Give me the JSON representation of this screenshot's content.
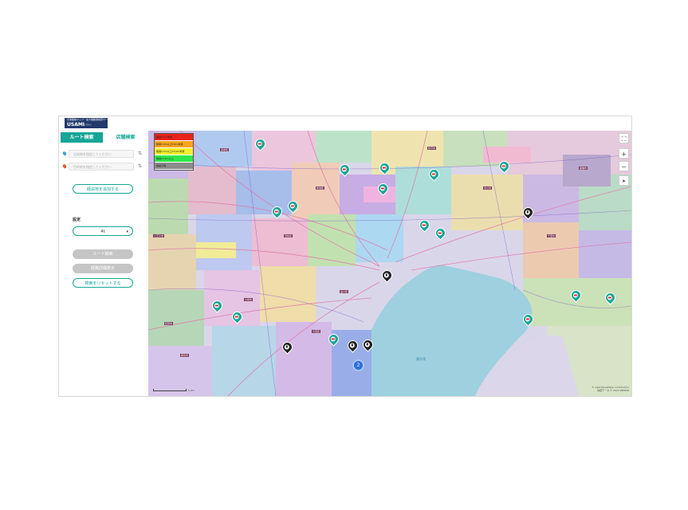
{
  "app": {
    "logo_line1": "渋滞路線マップ・最大積載量検索サービス",
    "logo_name": "USAMI",
    "logo_sub": "システム"
  },
  "sidebar": {
    "tabs": [
      {
        "label": "ルート検索",
        "active": true
      },
      {
        "label": "店舗検索",
        "active": false
      }
    ],
    "origin_placeholder": "出発地を指定してください",
    "destination_placeholder": "目的地を指定してください",
    "add_waypoint_label": "経由地を追加する",
    "settings_label": "設定",
    "period_value": "4t",
    "route_search_label": "ルート検索",
    "route_detail_label": "経路詳細表示",
    "reset_label": "検索をリセットする"
  },
  "map": {
    "legend": [
      {
        "label": "幅員3.0m未満",
        "color": "#e8231c"
      },
      {
        "label": "幅員3.0m以上5.5m未満",
        "color": "#f5a31a"
      },
      {
        "label": "幅員5.5m以上13.0m未満",
        "color": "#f1ee2c"
      },
      {
        "label": "幅員13.0m以上",
        "color": "#2ee84a"
      },
      {
        "label": "幅員不明",
        "color": "#8c8c8c"
      }
    ],
    "zoom_in": "+",
    "zoom_out": "−",
    "fullscreen": "⛶",
    "locate": "➤",
    "bay_label": "東京湾",
    "cluster_count": "2",
    "scale_label": "5 km",
    "attribution_line1": "© OpenStreetMap contributors",
    "attribution_line2": "地図データ © 2023 ZENRIN",
    "place_labels": [
      "多摩区",
      "新宿区",
      "渋谷区",
      "品川区",
      "大田区",
      "川崎市",
      "横浜市",
      "千葉市",
      "市川市",
      "船橋市",
      "松戸市",
      "八王子市",
      "町田市"
    ],
    "markers_shop": 16,
    "markers_fuel": 5
  },
  "colors": {
    "accent": "#16a596",
    "water": "#9fd0df",
    "logo": "#1f3a6b"
  }
}
